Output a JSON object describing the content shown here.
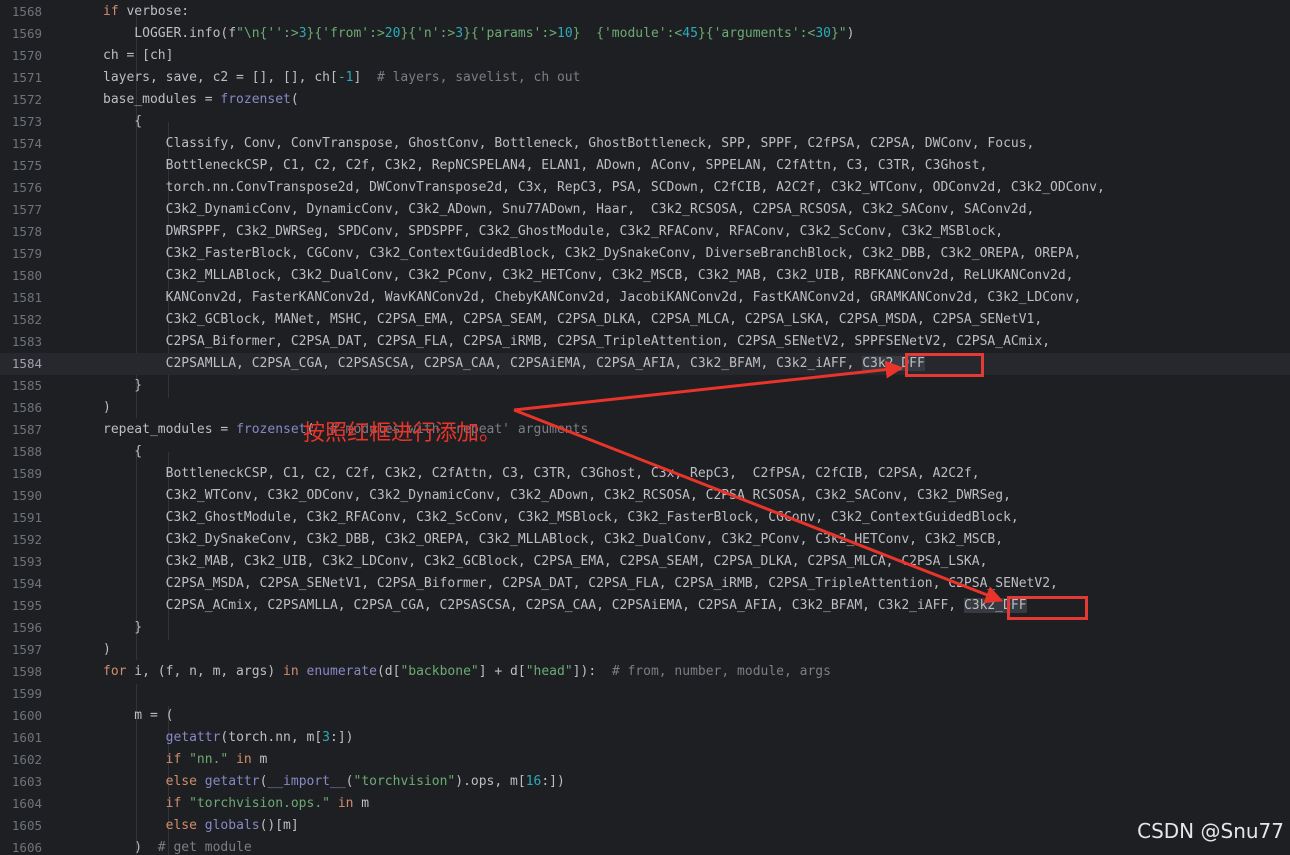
{
  "editor": {
    "current_line": "1584",
    "lines": [
      {
        "n": "1568",
        "segs": [
          {
            "t": "if",
            "c": "kw"
          },
          {
            "t": " verbose:"
          }
        ]
      },
      {
        "n": "1569",
        "segs": [
          {
            "t": "    LOGGER.info(f"
          },
          {
            "t": "\"\\n{",
            "c": "str"
          },
          {
            "t": "''",
            "c": "str"
          },
          {
            "t": ":>",
            "c": "str"
          },
          {
            "t": "3",
            "c": "num"
          },
          {
            "t": "}{",
            "c": "str"
          },
          {
            "t": "'from'",
            "c": "str"
          },
          {
            "t": ":>",
            "c": "str"
          },
          {
            "t": "20",
            "c": "num"
          },
          {
            "t": "}{",
            "c": "str"
          },
          {
            "t": "'n'",
            "c": "str"
          },
          {
            "t": ":>",
            "c": "str"
          },
          {
            "t": "3",
            "c": "num"
          },
          {
            "t": "}{",
            "c": "str"
          },
          {
            "t": "'params'",
            "c": "str"
          },
          {
            "t": ":>",
            "c": "str"
          },
          {
            "t": "10",
            "c": "num"
          },
          {
            "t": "}  {",
            "c": "str"
          },
          {
            "t": "'module'",
            "c": "str"
          },
          {
            "t": ":<",
            "c": "str"
          },
          {
            "t": "45",
            "c": "num"
          },
          {
            "t": "}{",
            "c": "str"
          },
          {
            "t": "'arguments'",
            "c": "str"
          },
          {
            "t": ":<",
            "c": "str"
          },
          {
            "t": "30",
            "c": "num"
          },
          {
            "t": "}\"",
            "c": "str"
          },
          {
            "t": ")"
          }
        ]
      },
      {
        "n": "1570",
        "segs": [
          {
            "t": "ch = [ch]"
          }
        ]
      },
      {
        "n": "1571",
        "segs": [
          {
            "t": "layers, save, c2 = [], [], ch["
          },
          {
            "t": "-1",
            "c": "num"
          },
          {
            "t": "]  "
          },
          {
            "t": "# layers, savelist, ch out",
            "c": "cmt"
          }
        ]
      },
      {
        "n": "1572",
        "segs": [
          {
            "t": "base_modules = "
          },
          {
            "t": "frozenset",
            "c": "bi"
          },
          {
            "t": "("
          }
        ]
      },
      {
        "n": "1573",
        "segs": [
          {
            "t": "    {"
          }
        ]
      },
      {
        "n": "1574",
        "segs": [
          {
            "t": "        Classify, Conv, ConvTranspose, GhostConv, Bottleneck, GhostBottleneck, SPP, SPPF, C2fPSA, C2PSA, DWConv, Focus,"
          }
        ]
      },
      {
        "n": "1575",
        "segs": [
          {
            "t": "        BottleneckCSP, C1, C2, C2f, C3k2, RepNCSPELAN4, ELAN1, ADown, AConv, SPPELAN, C2fAttn, C3, C3TR, C3Ghost,"
          }
        ]
      },
      {
        "n": "1576",
        "segs": [
          {
            "t": "        torch.nn.ConvTranspose2d, DWConvTranspose2d, C3x, RepC3, PSA, SCDown, C2fCIB, A2C2f, C3k2_WTConv, ODConv2d, C3k2_ODConv,"
          }
        ]
      },
      {
        "n": "1577",
        "segs": [
          {
            "t": "        C3k2_DynamicConv, DynamicConv, C3k2_ADown, Snu77ADown, Haar,  C3k2_RCSOSA, C2PSA_RCSOSA, C3k2_SAConv, SAConv2d,"
          }
        ]
      },
      {
        "n": "1578",
        "segs": [
          {
            "t": "        DWRSPPF, C3k2_DWRSeg, SPDConv, SPDSPPF, C3k2_GhostModule, C3k2_RFAConv, RFAConv, C3k2_ScConv, C3k2_MSBlock,"
          }
        ]
      },
      {
        "n": "1579",
        "segs": [
          {
            "t": "        C3k2_FasterBlock, CGConv, C3k2_ContextGuidedBlock, C3k2_DySnakeConv, DiverseBranchBlock, C3k2_DBB, C3k2_OREPA, OREPA,"
          }
        ]
      },
      {
        "n": "1580",
        "segs": [
          {
            "t": "        C3k2_MLLABlock, C3k2_DualConv, C3k2_PConv, C3k2_HETConv, C3k2_MSCB, C3k2_MAB, C3k2_UIB, RBFKANConv2d, ReLUKANConv2d,"
          }
        ]
      },
      {
        "n": "1581",
        "segs": [
          {
            "t": "        KANConv2d, FasterKANConv2d, WavKANConv2d, ChebyKANConv2d, JacobiKANConv2d, FastKANConv2d, GRAMKANConv2d, C3k2_LDConv,"
          }
        ]
      },
      {
        "n": "1582",
        "segs": [
          {
            "t": "        C3k2_GCBlock, MANet, MSHC, C2PSA_EMA, C2PSA_SEAM, C2PSA_DLKA, C2PSA_MLCA, C2PSA_LSKA, C2PSA_MSDA, C2PSA_SENetV1,"
          }
        ]
      },
      {
        "n": "1583",
        "segs": [
          {
            "t": "        C2PSA_Biformer, C2PSA_DAT, C2PSA_FLA, C2PSA_iRMB, C2PSA_TripleAttention, C2PSA_SENetV2, SPPFSENetV2, C2PSA_ACmix,"
          }
        ]
      },
      {
        "n": "1584",
        "segs": [
          {
            "t": "        C2PSAMLLA, C2PSA_CGA, C2PSASCSA, C2PSA_CAA, C2PSAiEMA, C2PSA_AFIA, C3k2_BFAM, C3k2_iAFF, "
          },
          {
            "t": "C3k2_DFF",
            "c": "hl"
          }
        ]
      },
      {
        "n": "1585",
        "segs": [
          {
            "t": "    }"
          }
        ]
      },
      {
        "n": "1586",
        "segs": [
          {
            "t": ")"
          }
        ]
      },
      {
        "n": "1587",
        "segs": [
          {
            "t": "repeat_modules = "
          },
          {
            "t": "frozenset",
            "c": "bi"
          },
          {
            "t": "(  "
          },
          {
            "t": "# modules with 'repeat' arguments",
            "c": "cmt"
          }
        ]
      },
      {
        "n": "1588",
        "segs": [
          {
            "t": "    {"
          }
        ]
      },
      {
        "n": "1589",
        "segs": [
          {
            "t": "        BottleneckCSP, C1, C2, C2f, C3k2, C2fAttn, C3, C3TR, C3Ghost, C3x, RepC3,  C2fPSA, C2fCIB, C2PSA, A2C2f,"
          }
        ]
      },
      {
        "n": "1590",
        "segs": [
          {
            "t": "        C3k2_WTConv, C3k2_ODConv, C3k2_DynamicConv, C3k2_ADown, C3k2_RCSOSA, C2PSA_RCSOSA, C3k2_SAConv, C3k2_DWRSeg,"
          }
        ]
      },
      {
        "n": "1591",
        "segs": [
          {
            "t": "        C3k2_GhostModule, C3k2_RFAConv, C3k2_ScConv, C3k2_MSBlock, C3k2_FasterBlock, CGConv, C3k2_ContextGuidedBlock,"
          }
        ]
      },
      {
        "n": "1592",
        "segs": [
          {
            "t": "        C3k2_DySnakeConv, C3k2_DBB, C3k2_OREPA, C3k2_MLLABlock, C3k2_DualConv, C3k2_PConv, C3k2_HETConv, C3k2_MSCB,"
          }
        ]
      },
      {
        "n": "1593",
        "segs": [
          {
            "t": "        C3k2_MAB, C3k2_UIB, C3k2_LDConv, C3k2_GCBlock, C2PSA_EMA, C2PSA_SEAM, C2PSA_DLKA, C2PSA_MLCA, C2PSA_LSKA,"
          }
        ]
      },
      {
        "n": "1594",
        "segs": [
          {
            "t": "        C2PSA_MSDA, C2PSA_SENetV1, C2PSA_Biformer, C2PSA_DAT, C2PSA_FLA, C2PSA_iRMB, C2PSA_TripleAttention, C2PSA_SENetV2,"
          }
        ]
      },
      {
        "n": "1595",
        "segs": [
          {
            "t": "        C2PSA_ACmix, C2PSAMLLA, C2PSA_CGA, C2PSASCSA, C2PSA_CAA, C2PSAiEMA, C2PSA_AFIA, C3k2_BFAM, C3k2_iAFF, "
          },
          {
            "t": "C3k2_DFF",
            "c": "hl"
          }
        ]
      },
      {
        "n": "1596",
        "segs": [
          {
            "t": "    }"
          }
        ]
      },
      {
        "n": "1597",
        "segs": [
          {
            "t": ")"
          }
        ]
      },
      {
        "n": "1598",
        "segs": [
          {
            "t": "for",
            "c": "kw"
          },
          {
            "t": " i, (f, n, m, args) "
          },
          {
            "t": "in",
            "c": "kw"
          },
          {
            "t": " "
          },
          {
            "t": "enumerate",
            "c": "bi"
          },
          {
            "t": "(d["
          },
          {
            "t": "\"backbone\"",
            "c": "str"
          },
          {
            "t": "] + d["
          },
          {
            "t": "\"head\"",
            "c": "str"
          },
          {
            "t": "]):  "
          },
          {
            "t": "# from, number, module, args",
            "c": "cmt"
          }
        ]
      },
      {
        "n": "1599",
        "segs": [
          {
            "t": ""
          }
        ]
      },
      {
        "n": "1600",
        "segs": [
          {
            "t": "    m = ("
          }
        ]
      },
      {
        "n": "1601",
        "segs": [
          {
            "t": "        "
          },
          {
            "t": "getattr",
            "c": "bi"
          },
          {
            "t": "(torch.nn, m["
          },
          {
            "t": "3",
            "c": "num"
          },
          {
            "t": ":])"
          }
        ]
      },
      {
        "n": "1602",
        "segs": [
          {
            "t": "        "
          },
          {
            "t": "if",
            "c": "kw"
          },
          {
            "t": " "
          },
          {
            "t": "\"nn.\"",
            "c": "str"
          },
          {
            "t": " "
          },
          {
            "t": "in",
            "c": "kw"
          },
          {
            "t": " m"
          }
        ]
      },
      {
        "n": "1603",
        "segs": [
          {
            "t": "        "
          },
          {
            "t": "else",
            "c": "kw"
          },
          {
            "t": " "
          },
          {
            "t": "getattr",
            "c": "bi"
          },
          {
            "t": "("
          },
          {
            "t": "__import__",
            "c": "bi"
          },
          {
            "t": "("
          },
          {
            "t": "\"torchvision\"",
            "c": "str"
          },
          {
            "t": ").ops, m["
          },
          {
            "t": "16",
            "c": "num"
          },
          {
            "t": ":])"
          }
        ]
      },
      {
        "n": "1604",
        "segs": [
          {
            "t": "        "
          },
          {
            "t": "if",
            "c": "kw"
          },
          {
            "t": " "
          },
          {
            "t": "\"torchvision.ops.\"",
            "c": "str"
          },
          {
            "t": " "
          },
          {
            "t": "in",
            "c": "kw"
          },
          {
            "t": " m"
          }
        ]
      },
      {
        "n": "1605",
        "segs": [
          {
            "t": "        "
          },
          {
            "t": "else",
            "c": "kw"
          },
          {
            "t": " "
          },
          {
            "t": "globals",
            "c": "bi"
          },
          {
            "t": "()[m]"
          }
        ]
      },
      {
        "n": "1606",
        "segs": [
          {
            "t": "    )  "
          },
          {
            "t": "# get module",
            "c": "cmt"
          }
        ]
      }
    ]
  },
  "annotation": {
    "text": "按照红框进行添加。",
    "color": "#e53935"
  },
  "watermark": {
    "text": "CSDN @Snu77"
  }
}
